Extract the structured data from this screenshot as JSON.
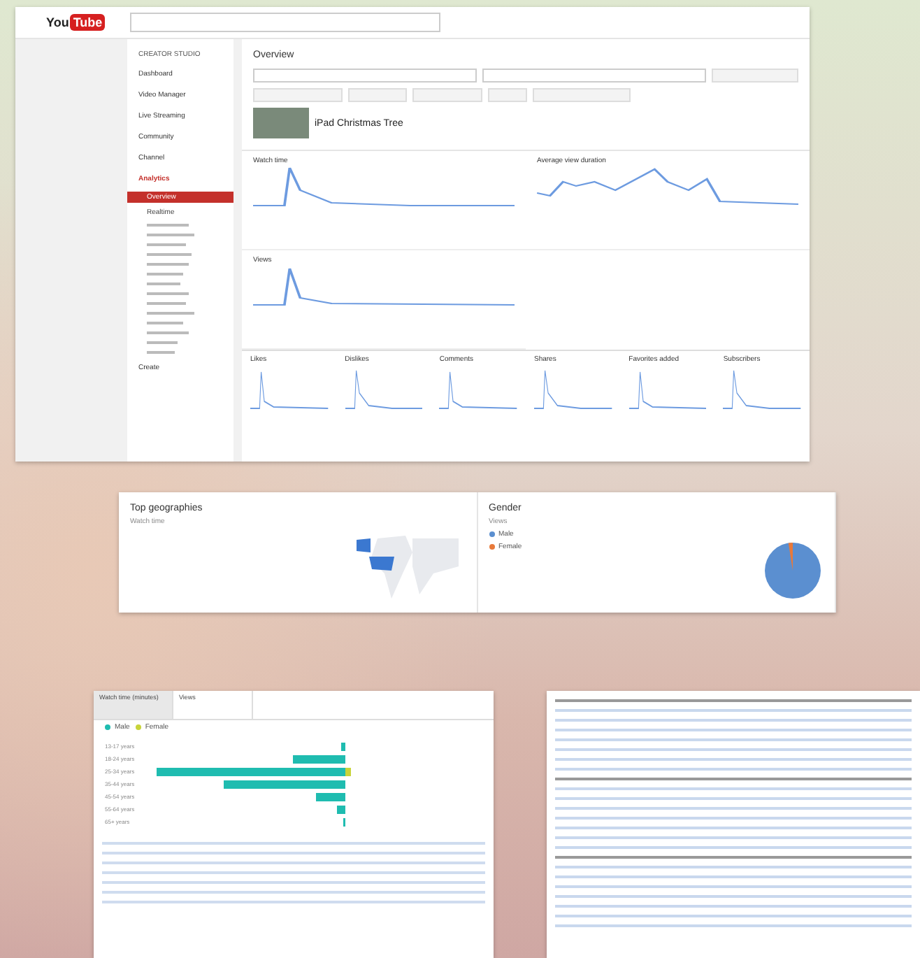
{
  "analytics_window": {
    "logo": {
      "first": "You",
      "second": "Tube"
    },
    "sidebar": {
      "heading": "CREATOR STUDIO",
      "items": [
        {
          "label": "Dashboard",
          "expanded": false
        },
        {
          "label": "Video Manager",
          "expanded": false
        },
        {
          "label": "Live Streaming",
          "expanded": false
        },
        {
          "label": "Community",
          "expanded": false
        },
        {
          "label": "Channel",
          "expanded": false
        },
        {
          "label": "Analytics",
          "expanded": true,
          "children": [
            {
              "label": "Overview",
              "selected": true
            },
            {
              "label": "Realtime",
              "selected": false
            }
          ]
        }
      ],
      "footer": "Create"
    },
    "main": {
      "title": "Overview",
      "video_title": "iPad Christmas Tree",
      "charts": [
        {
          "title": "Watch time"
        },
        {
          "title": "Average view duration"
        },
        {
          "title": "Views"
        }
      ],
      "metrics": [
        {
          "label": "Likes"
        },
        {
          "label": "Dislikes"
        },
        {
          "label": "Comments"
        },
        {
          "label": "Shares"
        },
        {
          "label": "Favorites added"
        },
        {
          "label": "Subscribers"
        }
      ]
    }
  },
  "geo_card": {
    "geographies": {
      "title": "Top geographies",
      "subtitle": "Watch time"
    },
    "gender": {
      "title": "Gender",
      "subtitle": "Views",
      "legend": [
        {
          "label": "Male",
          "color": "#5b8fd0"
        },
        {
          "label": "Female",
          "color": "#e8793a"
        }
      ]
    }
  },
  "age_panel": {
    "tabs": [
      {
        "label": "Watch time (minutes)",
        "selected": true
      },
      {
        "label": "Views",
        "selected": false
      }
    ],
    "legend": [
      {
        "label": "Male",
        "color": "#1fbcb0"
      },
      {
        "label": "Female",
        "color": "#c8d43a"
      }
    ],
    "groups": [
      "13-17 years",
      "18-24 years",
      "25-34 years",
      "35-44 years",
      "45-54 years",
      "55-64 years",
      "65+ years"
    ]
  }
}
